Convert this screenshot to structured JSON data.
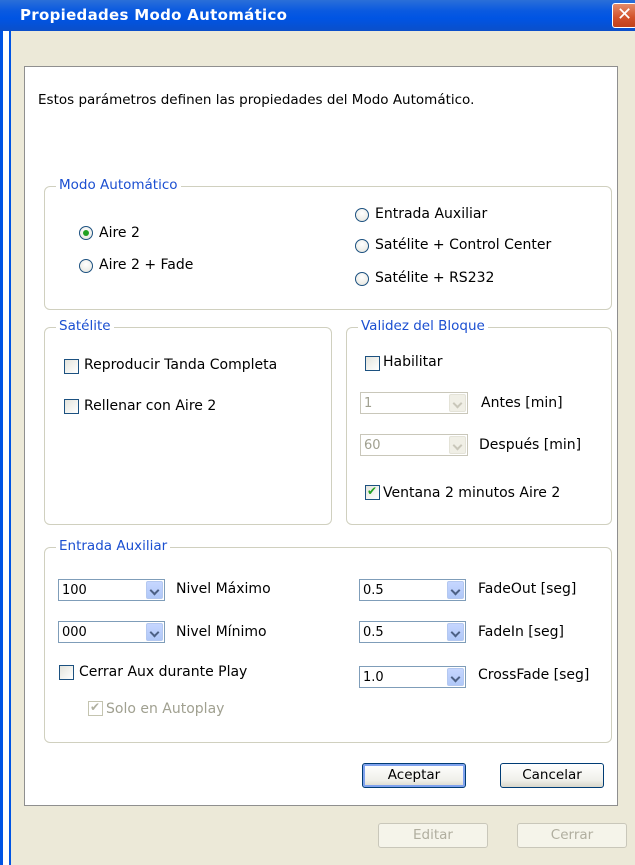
{
  "window": {
    "title": "Propiedades Modo Automático",
    "close_symbol": "✕"
  },
  "description": "Estos parámetros definen las propiedades del Modo Automático.",
  "modo": {
    "legend": "Modo Automático",
    "options": [
      "Aire 2",
      "Aire 2 + Fade",
      "Entrada Auxiliar",
      "Satélite + Control Center",
      "Satélite + RS232"
    ],
    "selected": "Aire 2"
  },
  "satelite": {
    "legend": "Satélite",
    "reproducir": "Reproducir Tanda Completa",
    "rellenar": "Rellenar con Aire 2"
  },
  "validez": {
    "legend": "Validez del Bloque",
    "habilitar": "Habilitar",
    "antes_value": "1",
    "antes_label": "Antes [min]",
    "despues_value": "60",
    "despues_label": "Después [min]",
    "ventana": "Ventana 2 minutos Aire 2"
  },
  "auxiliar": {
    "legend": "Entrada Auxiliar",
    "nivel_max_value": "100",
    "nivel_max_label": "Nivel Máximo",
    "nivel_min_value": "000",
    "nivel_min_label": "Nivel Mínimo",
    "cerrar": "Cerrar Aux durante Play",
    "solo": "Solo en Autoplay",
    "fadeout_value": "0.5",
    "fadeout_label": "FadeOut [seg]",
    "fadein_value": "0.5",
    "fadein_label": "FadeIn [seg]",
    "crossfade_value": "1.0",
    "crossfade_label": "CrossFade [seg]"
  },
  "buttons": {
    "aceptar": "Aceptar",
    "cancelar": "Cancelar",
    "editar": "Editar",
    "cerrar": "Cerrar"
  },
  "colors": {
    "title_bar": "#0054e3",
    "legend_text": "#1b4fd1",
    "panel": "#ece9d8",
    "check_mark": "#21a121"
  }
}
